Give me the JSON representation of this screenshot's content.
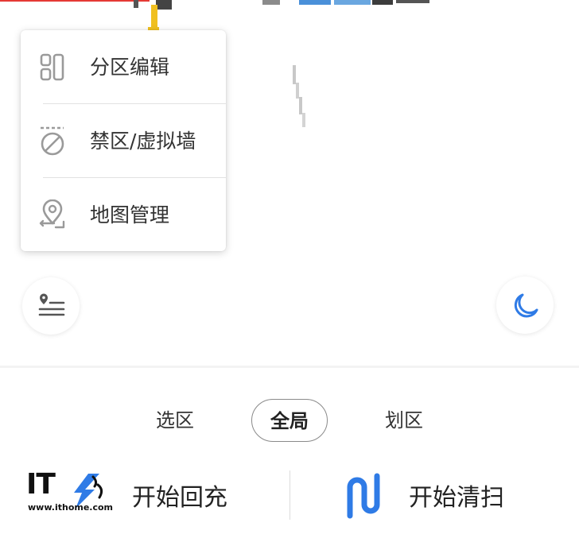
{
  "popup_menu": {
    "items": [
      {
        "label": "分区编辑",
        "icon": "partition-edit-icon"
      },
      {
        "label": "禁区/虚拟墙",
        "icon": "no-go-zone-icon"
      },
      {
        "label": "地图管理",
        "icon": "map-pin-icon"
      }
    ]
  },
  "floating_buttons": {
    "left_icon": "map-list-icon",
    "right_icon": "moon-icon"
  },
  "mode_tabs": {
    "items": [
      {
        "label": "选区",
        "active": false
      },
      {
        "label": "全局",
        "active": true
      },
      {
        "label": "划区",
        "active": false
      }
    ]
  },
  "actions": {
    "recharge_label": "开始回充",
    "clean_label": "开始清扫",
    "clean_icon": "sweep-path-icon"
  },
  "watermark": {
    "logo_text": "IT",
    "url": "www.ithome.com"
  },
  "colors": {
    "accent_blue": "#2f7be6",
    "icon_gray": "#9a9a9a",
    "text_dark": "#333333",
    "map_red_line": "#e53935",
    "map_yellow": "#f0c020"
  }
}
